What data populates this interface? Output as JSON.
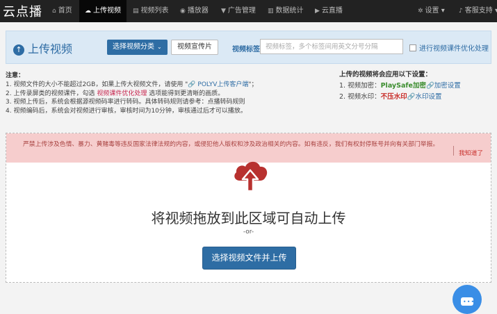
{
  "nav": {
    "logo": "云点播",
    "items": [
      {
        "label": "首页",
        "icon": "home-icon",
        "glyph": "⌂"
      },
      {
        "label": "上传视频",
        "icon": "cloud-upload-icon",
        "glyph": "☁"
      },
      {
        "label": "视频列表",
        "icon": "film-icon",
        "glyph": "▤"
      },
      {
        "label": "播放器",
        "icon": "play-circle-icon",
        "glyph": "◉"
      },
      {
        "label": "广告管理",
        "icon": "filter-icon",
        "glyph": "▼"
      },
      {
        "label": "数据统计",
        "icon": "chart-icon",
        "glyph": "▥"
      },
      {
        "label": "云直播",
        "icon": "video-camera-icon",
        "glyph": "▶"
      },
      {
        "label": "设置",
        "icon": "gear-icon",
        "glyph": "✲",
        "caret": "▾"
      },
      {
        "label": "客服支持",
        "icon": "bell-icon",
        "glyph": "♪",
        "caret": "▾"
      }
    ],
    "active": "上传视频"
  },
  "header": {
    "title": "上传视频",
    "category_button": "选择视频分类",
    "category_caret": "⌄",
    "promo_button": "视频宣传片",
    "tag_label": "视频标签",
    "tag_placeholder": "视频标签，多个标签间用英文分号分隔",
    "tag_value": "",
    "courseware_option": "进行视频课件优化处理"
  },
  "notes": {
    "title": "注意：",
    "line1_a": "1. 视频文件的大小不能超过2GB，如果上传大视频文件，请使用 \"",
    "line1_link": "🔗 POLYV上传客户端",
    "line1_b": "\"；",
    "line2_a": "2. 上传录屏类的视频课件，勾选 ",
    "line2_hl": "视频课件优化处理",
    "line2_b": " 选项能得到更清晰的画质。",
    "line3": "3. 视频上传后，系统会根据源视频码率进行转码。具体转码规则请参考：点播转码规则",
    "line4": "4. 视频编码后，系统会对视频进行审核，审核时间为10分钟，审核通过后才可以播放。"
  },
  "settings": {
    "title": "上传的视频将会应用以下设置：",
    "encrypt_label": "1. 视频加密：",
    "encrypt_value": "PlaySafe加密",
    "encrypt_link": "🔗加密设置",
    "watermark_label": "2. 视频水印：",
    "watermark_value": "不压水印",
    "watermark_link": "🔗水印设置"
  },
  "upload": {
    "warning": "严禁上传涉及色情、暴力、黄赌毒等违反国家法律法规的内容，或侵犯他人版权和涉及政治相关的内容。如有违反，我们有权封停账号并向有关部门举报。",
    "acknowledge": "我知道了",
    "drop_text": "将视频拖放到此区域可自动上传",
    "or_text": "-or-",
    "select_button": "选择视频文件并上传",
    "accent_color": "#b8312f",
    "button_color": "#2e6da4"
  },
  "chat": {
    "icon": "chat-bubble-icon",
    "dots": "•••"
  }
}
